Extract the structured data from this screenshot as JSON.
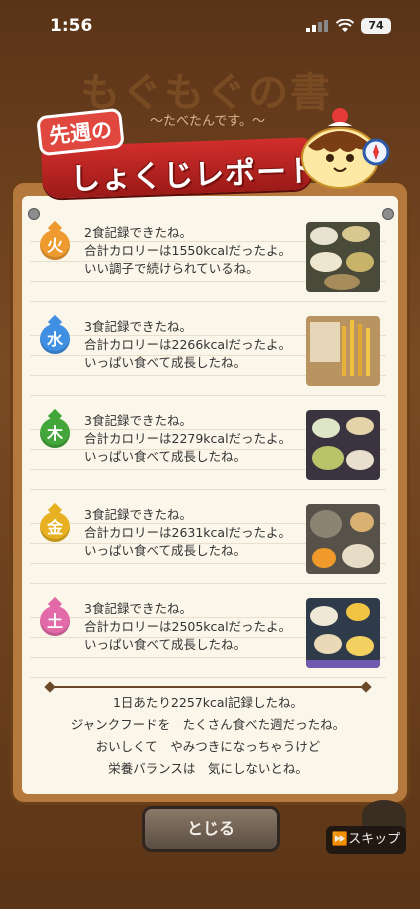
{
  "status": {
    "time": "1:56",
    "battery": "74"
  },
  "background": {
    "title": "もぐもぐの書",
    "subtitle": "〜たべたんです。〜"
  },
  "ribbon": {
    "small": "先週の",
    "big": "しょくじレポート"
  },
  "entries": [
    {
      "day": "火",
      "color": "#ee9a2e",
      "line1": "2食記録できたね。",
      "line2": "合計カロリーは1550kcalだったよ。",
      "line3": "いい調子で続けられているね。"
    },
    {
      "day": "水",
      "color": "#3f8fe3",
      "line1": "3食記録できたね。",
      "line2": "合計カロリーは2266kcalだったよ。",
      "line3": "いっぱい食べて成長したね。"
    },
    {
      "day": "木",
      "color": "#43a63a",
      "line1": "3食記録できたね。",
      "line2": "合計カロリーは2279kcalだったよ。",
      "line3": "いっぱい食べて成長したね。"
    },
    {
      "day": "金",
      "color": "#e6b021",
      "line1": "3食記録できたね。",
      "line2": "合計カロリーは2631kcalだったよ。",
      "line3": "いっぱい食べて成長したね。"
    },
    {
      "day": "土",
      "color": "#e26aa8",
      "line1": "3食記録できたね。",
      "line2": "合計カロリーは2505kcalだったよ。",
      "line3": "いっぱい食べて成長したね。"
    }
  ],
  "summary": {
    "line1": "1日あたり2257kcal記録したね。",
    "line2": "ジャンクフードを　たくさん食べた週だったね。",
    "line3": "おいしくて　やみつきになっちゃうけど",
    "line4": "栄養バランスは　気にしないとね。"
  },
  "buttons": {
    "close": "とじる",
    "skip": "スキップ"
  }
}
